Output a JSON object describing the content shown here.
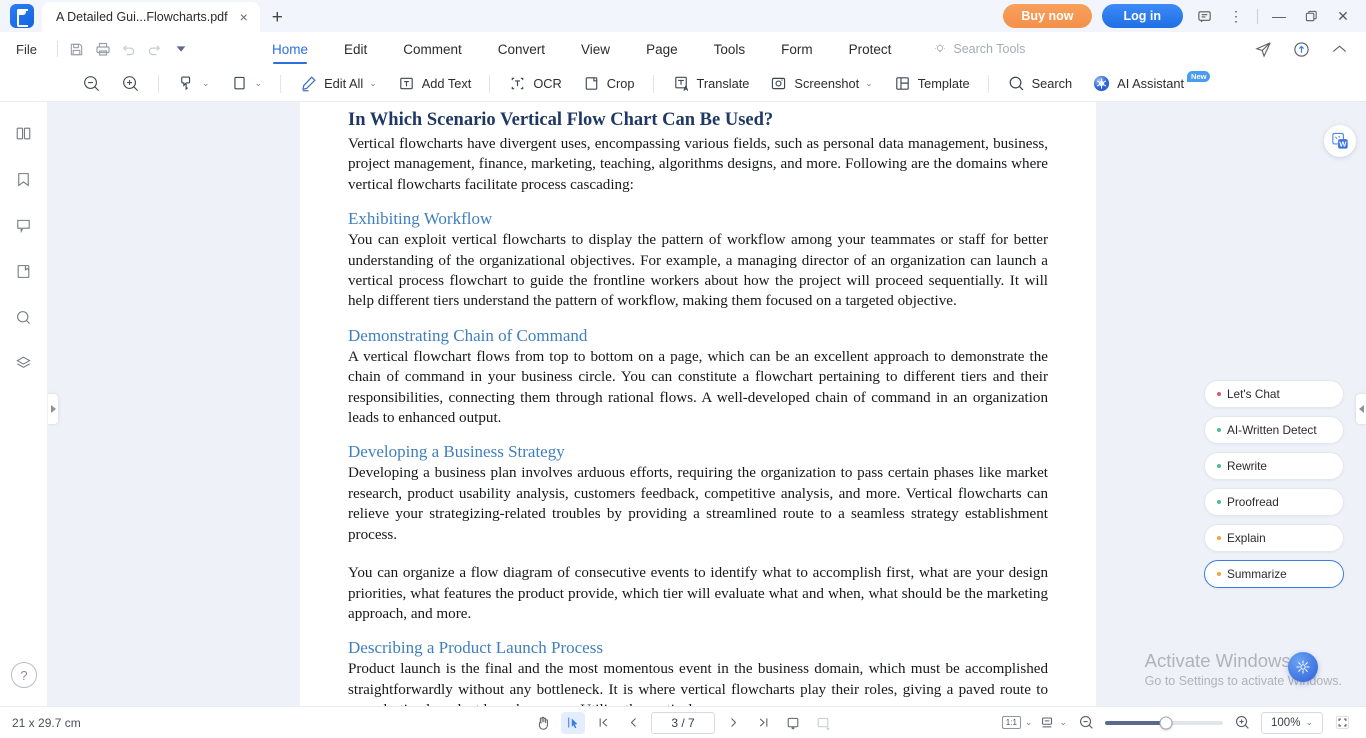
{
  "titlebar": {
    "logo_name": "wondershare-pdfelement-logo",
    "tab_title": "A Detailed Gui...Flowcharts.pdf",
    "tab_close": "×",
    "new_tab": "+",
    "buy_now": "Buy now",
    "log_in": "Log in",
    "feedback_icon": "feedback-icon",
    "more_icon": "⋮",
    "minimize": "—",
    "maximize": "❐",
    "close": "✕"
  },
  "menubar": {
    "file": "File",
    "quick_icons": [
      "save-icon",
      "print-icon",
      "undo-icon",
      "redo-icon",
      "customize-caret-icon"
    ],
    "tabs": [
      {
        "label": "Home",
        "active": true
      },
      {
        "label": "Edit",
        "active": false
      },
      {
        "label": "Comment",
        "active": false
      },
      {
        "label": "Convert",
        "active": false
      },
      {
        "label": "View",
        "active": false
      },
      {
        "label": "Page",
        "active": false
      },
      {
        "label": "Tools",
        "active": false
      },
      {
        "label": "Form",
        "active": false
      },
      {
        "label": "Protect",
        "active": false
      }
    ],
    "search_tools_placeholder": "Search Tools",
    "right_icons": [
      "share-icon",
      "cloud-upload-icon",
      "collapse-ribbon-icon"
    ]
  },
  "toolbar": {
    "zoom_out": "zoom-out-icon",
    "zoom_in": "zoom-in-icon",
    "select_tool": "select-tool-icon",
    "page_view": "page-view-icon",
    "items": [
      {
        "label": "Edit All",
        "icon": "pencil-icon",
        "caret": true
      },
      {
        "label": "Add Text",
        "icon": "add-text-icon",
        "caret": false
      },
      {
        "label": "OCR",
        "icon": "ocr-icon",
        "caret": false
      },
      {
        "label": "Crop",
        "icon": "crop-icon",
        "caret": false
      },
      {
        "label": "Translate",
        "icon": "translate-icon",
        "caret": false
      },
      {
        "label": "Screenshot",
        "icon": "screenshot-icon",
        "caret": true
      },
      {
        "label": "Template",
        "icon": "template-icon",
        "caret": false
      },
      {
        "label": "Search",
        "icon": "search-icon",
        "caret": false
      },
      {
        "label": "AI Assistant",
        "icon": "ai-assistant-icon",
        "caret": false,
        "badge": "New"
      }
    ]
  },
  "rail": {
    "items": [
      {
        "name": "thumbnails-icon"
      },
      {
        "name": "bookmark-icon"
      },
      {
        "name": "comment-icon"
      },
      {
        "name": "attachment-icon"
      },
      {
        "name": "search-icon"
      },
      {
        "name": "layers-icon"
      }
    ],
    "help": "?"
  },
  "document": {
    "heading": "In Which Scenario Vertical Flow Chart Can Be Used?",
    "intro": "Vertical flowcharts have divergent uses, encompassing various fields, such as personal data management, business, project management, finance, marketing, teaching, algorithms designs, and more. Following are the domains where vertical flowcharts facilitate process cascading:",
    "sections": [
      {
        "heading": "Exhibiting Workflow",
        "paragraphs": [
          "You can exploit vertical flowcharts to display the pattern of workflow among your teammates or staff for better understanding of the organizational objectives. For example, a managing director of an organization can launch a vertical process flowchart to guide the frontline workers about how the project will proceed sequentially. It will help different tiers understand the pattern of workflow, making them focused on a targeted objective."
        ]
      },
      {
        "heading": "Demonstrating Chain of Command",
        "paragraphs": [
          "A vertical flowchart flows from top to bottom on a page, which can be an excellent approach to demonstrate the chain of command in your business circle. You can constitute a flowchart pertaining to different tiers and their responsibilities, connecting them through rational flows. A well-developed chain of command in an organization leads to enhanced output."
        ]
      },
      {
        "heading": "Developing a Business Strategy",
        "paragraphs": [
          "Developing a business plan involves arduous efforts, requiring the organization to pass certain phases like market research, product usability analysis, customers feedback, competitive analysis, and more. Vertical flowcharts can relieve your strategizing-related troubles by providing a streamlined route to a seamless strategy establishment process.",
          "You can organize a flow diagram of consecutive events to identify what to accomplish first, what are your design priorities, what features the product provide, which tier will evaluate what and when, what should be the marketing approach, and more."
        ]
      },
      {
        "heading": "Describing a Product Launch Process",
        "paragraphs": [
          "Product launch is the final and the most momentous event in the business domain, which must be accomplished straightforwardly without any bottleneck. It is where vertical flowcharts play their roles, giving a paved route to your destined product launch process. Utilize the vertical"
        ]
      }
    ]
  },
  "ai_panel": {
    "buttons": [
      {
        "label": "Let's Chat",
        "dot": "#e0566f",
        "selected": false
      },
      {
        "label": "AI-Written Detect",
        "dot": "#4cc08a",
        "selected": false
      },
      {
        "label": "Rewrite",
        "dot": "#4cc08a",
        "selected": false
      },
      {
        "label": "Proofread",
        "dot": "#4cc08a",
        "selected": false
      },
      {
        "label": "Explain",
        "dot": "#f0a33c",
        "selected": false
      },
      {
        "label": "Summarize",
        "dot": "#f0a33c",
        "selected": true
      }
    ],
    "fab": "ai-assistant-fab-icon",
    "convert_to_word": "convert-to-word-icon"
  },
  "watermark": {
    "line1": "Activate Windows",
    "line2": "Go to Settings to activate Windows."
  },
  "statusbar": {
    "page_size": "21 x 29.7 cm",
    "hand_tool": "hand-tool-icon",
    "select_tool": "select-tool-icon",
    "first_page": "first-page-icon",
    "prev_page": "prev-page-icon",
    "page_value": "3 / 7",
    "next_page": "next-page-icon",
    "last_page": "last-page-icon",
    "single_scroll": "single-page-scroll-icon",
    "continuous_scroll": "continuous-scroll-icon",
    "fit_label": "1:1",
    "layout_icon": "page-layout-icon",
    "zoom_out": "zoom-out-icon",
    "zoom_in": "zoom-in-icon",
    "zoom_value": "100%",
    "fullscreen": "fullscreen-icon"
  },
  "colors": {
    "accent": "#2c6fe0",
    "buy": "#f4904a",
    "doc_heading": "#1f3864",
    "doc_subheading": "#3f7fbf",
    "canvas": "#eef1f8"
  }
}
